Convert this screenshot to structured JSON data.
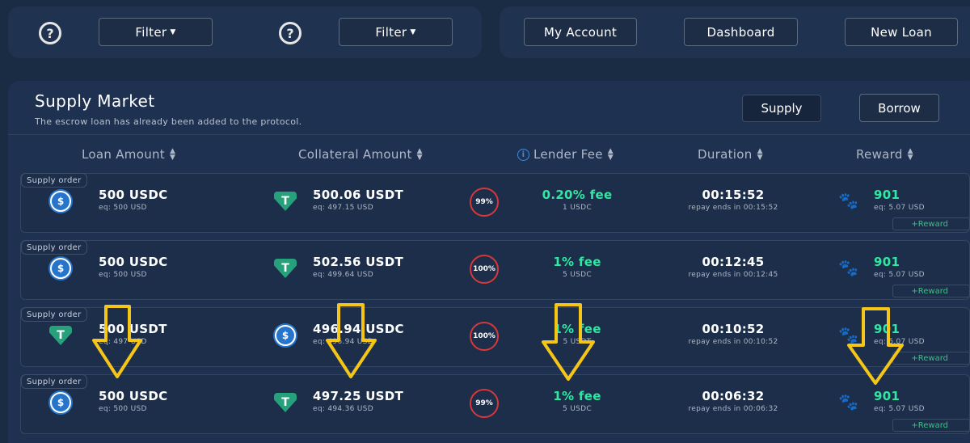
{
  "topbar": {
    "left": [
      {
        "type": "help",
        "label": "?"
      },
      {
        "type": "filter",
        "label": "Filter"
      },
      {
        "type": "help",
        "label": "?"
      },
      {
        "type": "filter",
        "label": "Filter"
      }
    ],
    "my_account": "My Account",
    "dashboard": "Dashboard",
    "new_loan": "New Loan"
  },
  "market": {
    "title": "Supply Market",
    "subtitle": "The escrow loan has already been added to the protocol.",
    "supply_label": "Supply",
    "borrow_label": "Borrow"
  },
  "columns": [
    "Loan Amount",
    "Collateral Amount",
    "Lender Fee",
    "Duration",
    "Reward"
  ],
  "rows": [
    {
      "tag": "Supply order",
      "loan_coin": "usdc",
      "loan": "500 USDC",
      "loan_eq": "eq: 500 USD",
      "coll_coin": "usdt",
      "collateral": "500.06 USDT",
      "collateral_eq": "eq: 497.15 USD",
      "ratio": "99%",
      "fee": "0.20% fee",
      "fee_sub": "1 USDC",
      "duration": "00:15:52",
      "duration_sub": "repay ends in 00:15:52",
      "reward": "901",
      "reward_eq": "eq: 5.07 USD",
      "reward_tag": "+Reward"
    },
    {
      "tag": "Supply order",
      "loan_coin": "usdc",
      "loan": "500 USDC",
      "loan_eq": "eq: 500 USD",
      "coll_coin": "usdt",
      "collateral": "502.56 USDT",
      "collateral_eq": "eq: 499.64 USD",
      "ratio": "100%",
      "fee": "1% fee",
      "fee_sub": "5 USDC",
      "duration": "00:12:45",
      "duration_sub": "repay ends in 00:12:45",
      "reward": "901",
      "reward_eq": "eq: 5.07 USD",
      "reward_tag": "+Reward"
    },
    {
      "tag": "Supply order",
      "loan_coin": "usdt",
      "loan": "500 USDT",
      "loan_eq": "eq: 497 USD",
      "coll_coin": "usdc",
      "collateral": "496.94 USDC",
      "collateral_eq": "eq: 496.94 USD",
      "ratio": "100%",
      "fee": "1% fee",
      "fee_sub": "5 USDT",
      "duration": "00:10:52",
      "duration_sub": "repay ends in 00:10:52",
      "reward": "901",
      "reward_eq": "eq: 5.07 USD",
      "reward_tag": "+Reward"
    },
    {
      "tag": "Supply order",
      "loan_coin": "usdc",
      "loan": "500 USDC",
      "loan_eq": "eq: 500 USD",
      "coll_coin": "usdt",
      "collateral": "497.25 USDT",
      "collateral_eq": "eq: 494.36 USD",
      "ratio": "99%",
      "fee": "1% fee",
      "fee_sub": "5 USDC",
      "duration": "00:06:32",
      "duration_sub": "repay ends in 00:06:32",
      "reward": "901",
      "reward_eq": "eq: 5.07 USD",
      "reward_tag": "+Reward"
    }
  ],
  "colors": {
    "accent_green": "#2fe8a2",
    "ratio_ring": "#d9373a",
    "arrow": "#f5c518",
    "info_blue": "#3e8de0"
  }
}
